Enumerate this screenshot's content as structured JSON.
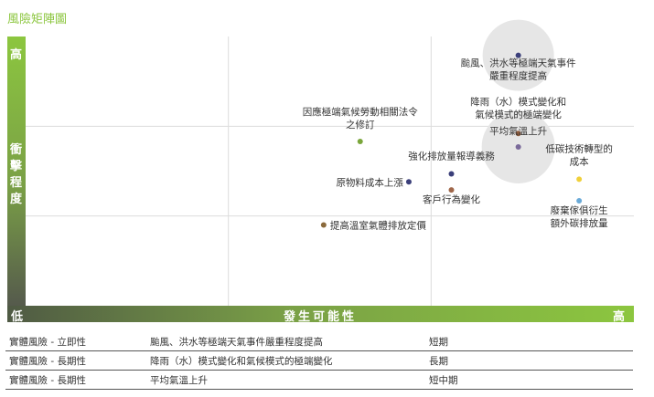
{
  "title": "風險矩陣圖",
  "chart_data": {
    "type": "scatter",
    "ylabel": "衝擊程度",
    "xlabel": "發生可能性",
    "y_low": "低",
    "y_high": "高",
    "x_high": "高",
    "points": [
      {
        "label": [
          "颱風、洪水等極端天氣事件",
          "嚴重程度提高"
        ],
        "x": 8.1,
        "y": 9.3,
        "color": "#3b3f7a",
        "halo": 1
      },
      {
        "label": [
          "降雨（水）模式變化和",
          "氣候模式的極端變化"
        ],
        "x": 8.1,
        "y": 6.4,
        "color": "#8b5a3c"
      },
      {
        "label": [
          "平均氣溫上升"
        ],
        "x": 8.1,
        "y": 5.9,
        "color": "#7a6a9a",
        "halo": 2
      },
      {
        "label": [
          "因應極端氣候勞動相關法令",
          "之修訂"
        ],
        "x": 5.5,
        "y": 6.1,
        "color": "#7aa63b"
      },
      {
        "label": [
          "低碳技術轉型的",
          "成本"
        ],
        "x": 9.1,
        "y": 4.7,
        "color": "#f0d03a"
      },
      {
        "label": [
          "強化排放量報導義務"
        ],
        "x": 7.0,
        "y": 4.9,
        "color": "#3b3f7a"
      },
      {
        "label": [
          "原物料成本上漲"
        ],
        "x": 6.3,
        "y": 4.6,
        "color": "#3b3f7a"
      },
      {
        "label": [
          "客戶行為變化"
        ],
        "x": 7.0,
        "y": 4.3,
        "color": "#a0674a"
      },
      {
        "label": [
          "廢棄傢俱衍生",
          "額外碳排放量"
        ],
        "x": 9.1,
        "y": 3.9,
        "color": "#6aaad8"
      },
      {
        "label": [
          "提高溫室氣體排放定價"
        ],
        "x": 4.9,
        "y": 3.0,
        "color": "#8b6a3c"
      }
    ]
  },
  "table": {
    "rows": [
      {
        "type": "實體風險 - 立即性",
        "risk": "颱風、洪水等極端天氣事件嚴重程度提高",
        "term": "短期"
      },
      {
        "type": "實體風險 - 長期性",
        "risk": "降雨（水）模式變化和氣候模式的極端變化",
        "term": "長期"
      },
      {
        "type": "實體風險 - 長期性",
        "risk": "平均氣溫上升",
        "term": "短中期"
      }
    ]
  }
}
